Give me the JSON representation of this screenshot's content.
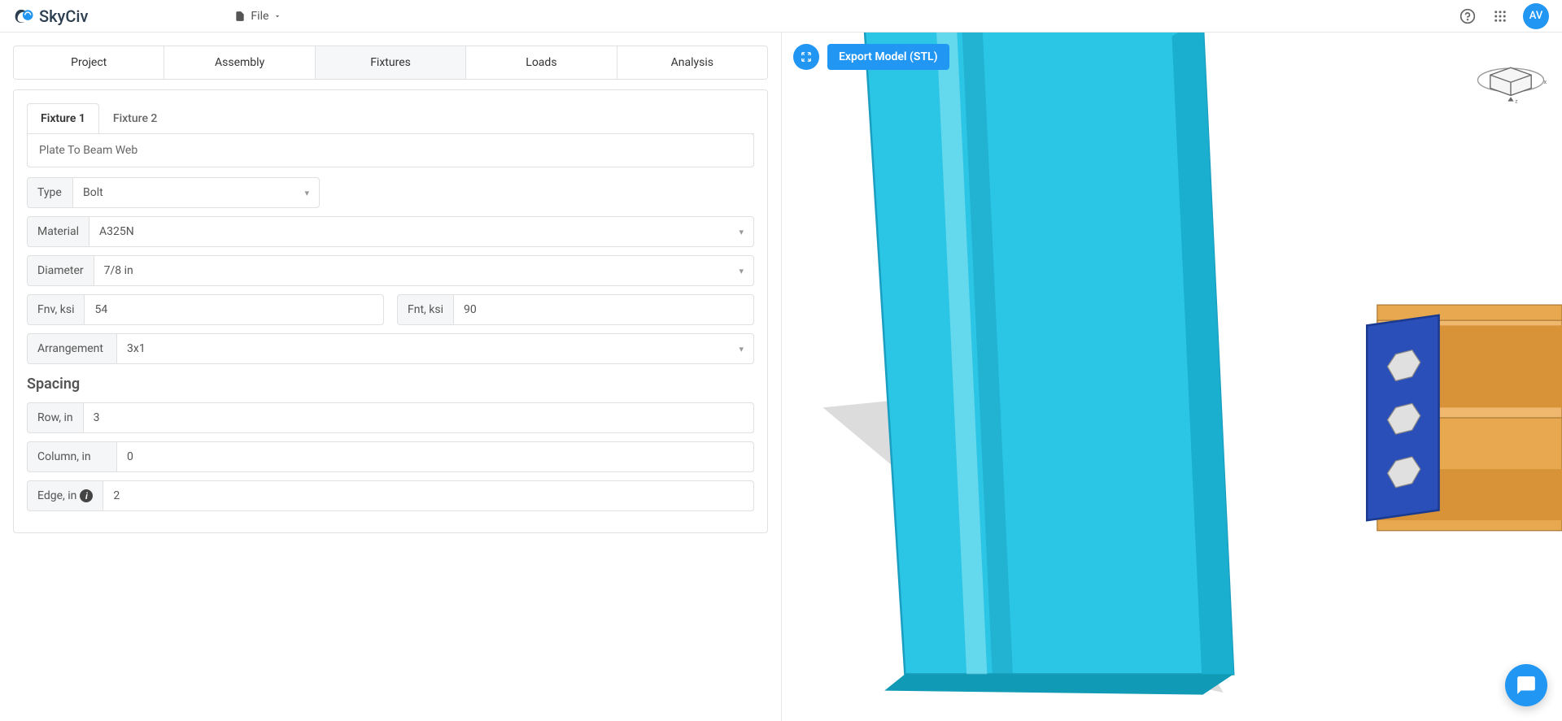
{
  "header": {
    "brand": "SkyCiv",
    "file_menu": "File",
    "avatar_initials": "AV"
  },
  "tabs": {
    "project": "Project",
    "assembly": "Assembly",
    "fixtures": "Fixtures",
    "loads": "Loads",
    "analysis": "Analysis"
  },
  "fixtures": {
    "tab1": "Fixture 1",
    "tab2": "Fixture 2",
    "title": "Plate To Beam Web",
    "labels": {
      "type": "Type",
      "material": "Material",
      "diameter": "Diameter",
      "fnv": "Fnv, ksi",
      "fnt": "Fnt, ksi",
      "arrangement": "Arrangement",
      "spacing": "Spacing",
      "row": "Row, in",
      "column": "Column, in",
      "edge": "Edge, in"
    },
    "values": {
      "type": "Bolt",
      "material": "A325N",
      "diameter": "7/8 in",
      "fnv": "54",
      "fnt": "90",
      "arrangement": "3x1",
      "row": "3",
      "column": "0",
      "edge": "2"
    }
  },
  "viewport": {
    "export_label": "Export Model (STL)"
  }
}
